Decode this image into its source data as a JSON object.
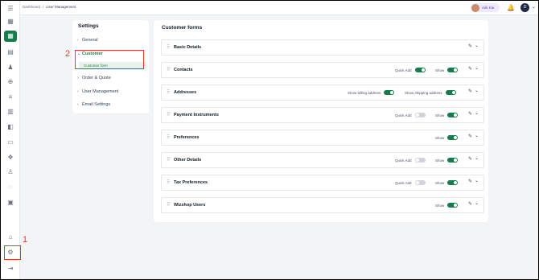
{
  "breadcrumb": {
    "home": "Dashboard",
    "separator": "/",
    "current": "User Management"
  },
  "topbar": {
    "ask_label": "Ask Kai",
    "user_initial": "D",
    "user_caret": "⌄"
  },
  "icons": {
    "menu": "☰",
    "rail": [
      "▦",
      "▦",
      "▤",
      "♟",
      "⊕",
      "≡",
      "▥",
      "◧",
      "▭",
      "❖",
      "♙",
      "◌",
      "▣"
    ],
    "bank": "⌂",
    "gear": "⚙",
    "logout": "⇥",
    "bell": "🔔",
    "grip": "⠿",
    "edit": "✎",
    "caret": "⌄",
    "chev_right": "›",
    "chev_down": "⌄"
  },
  "annotations": {
    "step1": "1",
    "step2": "2"
  },
  "settings": {
    "title": "Settings",
    "items": [
      {
        "label": "General",
        "state": "collapsed"
      },
      {
        "label": "Customer",
        "state": "expanded"
      },
      {
        "label": "Order & Quote",
        "state": "collapsed"
      },
      {
        "label": "User Management",
        "state": "collapsed"
      },
      {
        "label": "Email Settings",
        "state": "collapsed"
      }
    ],
    "sub_item": "Customer form"
  },
  "forms": {
    "title": "Customer forms",
    "rows": [
      {
        "title": "Basic Details"
      },
      {
        "title": "Contacts",
        "quick_add": "Quick Add",
        "quick_add_on": true,
        "show": "Show",
        "show_on": true
      },
      {
        "title": "Addresses",
        "billing": "Show billing address",
        "billing_on": true,
        "shipping": "Show shipping address",
        "shipping_on": true
      },
      {
        "title": "Payment Instruments",
        "quick_add": "Quick Add",
        "quick_add_on": false,
        "show": "Show",
        "show_on": true
      },
      {
        "title": "Preferences",
        "show": "Show",
        "show_on": true
      },
      {
        "title": "Other Details",
        "quick_add": "Quick Add",
        "quick_add_on": false,
        "show": "Show",
        "show_on": true
      },
      {
        "title": "Tax Preferences",
        "quick_add": "Quick Add",
        "quick_add_on": false,
        "show": "Show",
        "show_on": true
      },
      {
        "title": "Wizshop Users",
        "show": "Show",
        "show_on": true
      }
    ]
  },
  "colors": {
    "accent": "#1b7a4b",
    "highlight": "#e53935"
  }
}
